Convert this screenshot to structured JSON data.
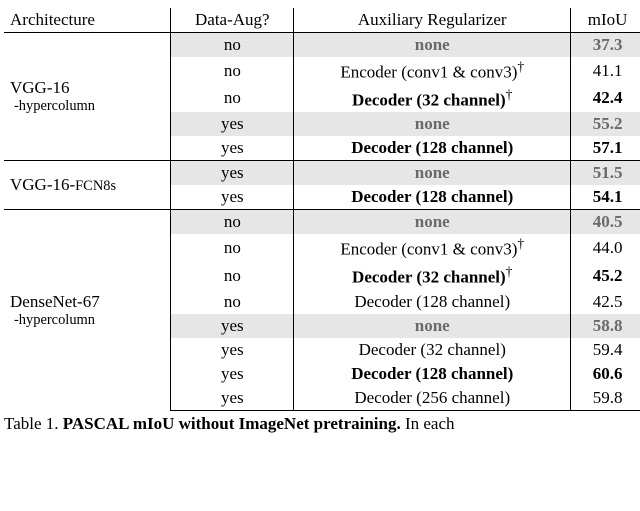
{
  "headers": {
    "c0": "Architecture",
    "c1": "Data-Aug?",
    "c2": "Auxiliary Regularizer",
    "c3": "mIoU"
  },
  "groups": [
    {
      "arch_main": "VGG-16",
      "arch_sub": "-hypercolumn",
      "rows": [
        {
          "aug": "no",
          "reg": "none",
          "miou": "37.3",
          "hl": true,
          "bold": false,
          "dagger": false
        },
        {
          "aug": "no",
          "reg": "Encoder (conv1 & conv3)",
          "miou": "41.1",
          "hl": false,
          "bold": false,
          "dagger": true
        },
        {
          "aug": "no",
          "reg": "Decoder (32 channel)",
          "miou": "42.4",
          "hl": false,
          "bold": true,
          "dagger": true
        },
        {
          "aug": "yes",
          "reg": "none",
          "miou": "55.2",
          "hl": true,
          "bold": false,
          "dagger": false
        },
        {
          "aug": "yes",
          "reg": "Decoder (128 channel)",
          "miou": "57.1",
          "hl": false,
          "bold": true,
          "dagger": false
        }
      ]
    },
    {
      "arch_main": "VGG-16-",
      "arch_sub_inline": "FCN8s",
      "rows": [
        {
          "aug": "yes",
          "reg": "none",
          "miou": "51.5",
          "hl": true,
          "bold": false,
          "dagger": false
        },
        {
          "aug": "yes",
          "reg": "Decoder (128 channel)",
          "miou": "54.1",
          "hl": false,
          "bold": true,
          "dagger": false
        }
      ]
    },
    {
      "arch_main": "DenseNet-67",
      "arch_sub": "-hypercolumn",
      "rows": [
        {
          "aug": "no",
          "reg": "none",
          "miou": "40.5",
          "hl": true,
          "bold": false,
          "dagger": false
        },
        {
          "aug": "no",
          "reg": "Encoder (conv1 & conv3)",
          "miou": "44.0",
          "hl": false,
          "bold": false,
          "dagger": true
        },
        {
          "aug": "no",
          "reg": "Decoder (32 channel)",
          "miou": "45.2",
          "hl": false,
          "bold": true,
          "dagger": true
        },
        {
          "aug": "no",
          "reg": "Decoder (128 channel)",
          "miou": "42.5",
          "hl": false,
          "bold": false,
          "dagger": false
        },
        {
          "aug": "yes",
          "reg": "none",
          "miou": "58.8",
          "hl": true,
          "bold": false,
          "dagger": false
        },
        {
          "aug": "yes",
          "reg": "Decoder (32 channel)",
          "miou": "59.4",
          "hl": false,
          "bold": false,
          "dagger": false
        },
        {
          "aug": "yes",
          "reg": "Decoder (128 channel)",
          "miou": "60.6",
          "hl": false,
          "bold": true,
          "dagger": false
        },
        {
          "aug": "yes",
          "reg": "Decoder (256 channel)",
          "miou": "59.8",
          "hl": false,
          "bold": false,
          "dagger": false
        }
      ]
    }
  ],
  "caption": {
    "prefix": "Table 1.",
    "title": "PASCAL mIoU without ImageNet pretraining.",
    "suffix": "In each"
  },
  "chart_data": {
    "type": "table",
    "title": "PASCAL mIoU without ImageNet pretraining",
    "columns": [
      "Architecture",
      "Data-Aug?",
      "Auxiliary Regularizer",
      "mIoU"
    ],
    "rows": [
      [
        "VGG-16-hypercolumn",
        "no",
        "none",
        37.3
      ],
      [
        "VGG-16-hypercolumn",
        "no",
        "Encoder (conv1 & conv3)",
        41.1
      ],
      [
        "VGG-16-hypercolumn",
        "no",
        "Decoder (32 channel)",
        42.4
      ],
      [
        "VGG-16-hypercolumn",
        "yes",
        "none",
        55.2
      ],
      [
        "VGG-16-hypercolumn",
        "yes",
        "Decoder (128 channel)",
        57.1
      ],
      [
        "VGG-16-FCN8s",
        "yes",
        "none",
        51.5
      ],
      [
        "VGG-16-FCN8s",
        "yes",
        "Decoder (128 channel)",
        54.1
      ],
      [
        "DenseNet-67-hypercolumn",
        "no",
        "none",
        40.5
      ],
      [
        "DenseNet-67-hypercolumn",
        "no",
        "Encoder (conv1 & conv3)",
        44.0
      ],
      [
        "DenseNet-67-hypercolumn",
        "no",
        "Decoder (32 channel)",
        45.2
      ],
      [
        "DenseNet-67-hypercolumn",
        "no",
        "Decoder (128 channel)",
        42.5
      ],
      [
        "DenseNet-67-hypercolumn",
        "yes",
        "none",
        58.8
      ],
      [
        "DenseNet-67-hypercolumn",
        "yes",
        "Decoder (32 channel)",
        59.4
      ],
      [
        "DenseNet-67-hypercolumn",
        "yes",
        "Decoder (128 channel)",
        60.6
      ],
      [
        "DenseNet-67-hypercolumn",
        "yes",
        "Decoder (256 channel)",
        59.8
      ]
    ]
  }
}
